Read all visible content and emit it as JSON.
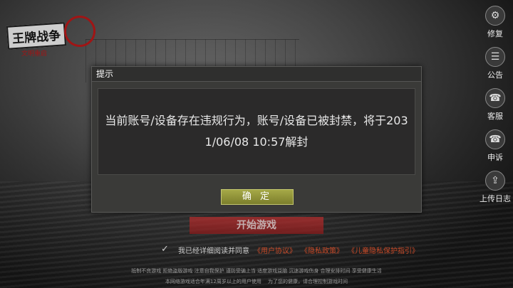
{
  "logo": {
    "main": "王牌战争",
    "sub": "文明重启"
  },
  "sidebar": {
    "items": [
      {
        "label": "修复",
        "icon": "gear-icon",
        "glyph": "⚙"
      },
      {
        "label": "公告",
        "icon": "announcement-icon",
        "glyph": "☰"
      },
      {
        "label": "客服",
        "icon": "headset-icon",
        "glyph": "☎"
      },
      {
        "label": "申诉",
        "icon": "appeal-headset-icon",
        "glyph": "☎"
      },
      {
        "label": "上传日志",
        "icon": "upload-icon",
        "glyph": "⇪"
      }
    ]
  },
  "dialog": {
    "title": "提示",
    "message": "当前账号/设备存在违规行为，账号/设备已被封禁，将于2031/06/08 10:57解封",
    "confirm_label": "确 定"
  },
  "start_button": "开始游戏",
  "agreement": {
    "checkbox_glyph": "✓",
    "text": "我已经详细阅读并同意",
    "links": [
      "《用户协议》",
      "《隐私政策》",
      "《儿童隐私保护指引》"
    ]
  },
  "footer": {
    "line1": "抵制不良游戏 拒绝盗版游戏 注意自我保护 谨防受骗上当 适度游戏益脑 沉迷游戏伤身 合理安排时间 享受健康生活",
    "line2": "本网络游戏适合年满12周岁以上的用户使用　 为了您的健康，请合理控制游戏时间"
  }
}
